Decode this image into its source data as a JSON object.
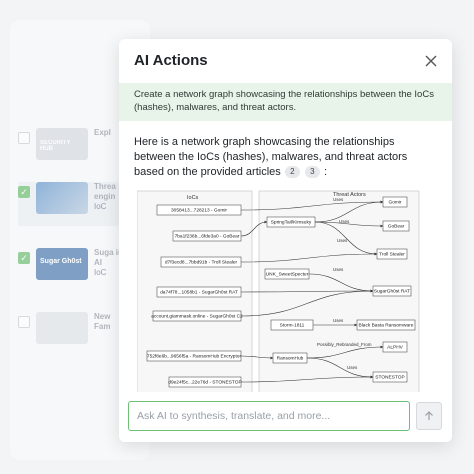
{
  "modal": {
    "title": "AI Actions",
    "prompt": "Create a network graph showcasing the relationships between the IoCs (hashes), malwares, and threat actors.",
    "answer_text": "Here is a network graph showcasing the relationships between the IoCs (hashes), malwares, and threat actors based on the provided articles",
    "answer_suffix": ":",
    "citations": [
      "2",
      "3"
    ]
  },
  "input": {
    "placeholder": "Ask AI to synthesis, translate, and more..."
  },
  "background_list": {
    "items": [
      {
        "title": "Expl",
        "tag": "",
        "checked": false
      },
      {
        "title": "Threa engin",
        "tag": "IoC",
        "checked": true
      },
      {
        "title": "Suga in AI",
        "tag": "IoC",
        "checked": true
      },
      {
        "title": "New Fam",
        "tag": "",
        "checked": false
      }
    ],
    "thumb_labels": [
      "SECURITY HUB",
      "Sugar Gh0st"
    ]
  },
  "graph": {
    "ioc_group_label": "IoCs",
    "actor_group_label": "Threat Actors",
    "iocs": [
      "3058413...728213 - Gomir",
      "7ba1f236b...6fde3a0 - GoBear",
      "d7f3ecd8...7bbd91b - Troll Stealer",
      "da74f78...1058b1 - SugarGh0st RAT",
      "account.giammask.online - SugarGh0st C2",
      "752f8e6b...9656f5a - RansomHub Encryptor",
      "d9e24f5c...22e76d - STONESTOP"
    ],
    "actors": [
      "SpringTail/Kimsuky",
      "UNK_SweetSpecter",
      "Storm-1811",
      "RansomHub"
    ],
    "malwares": [
      "Gomir",
      "GoBear",
      "Troll Stealer",
      "SugarGh0st RAT",
      "Black Basta Ransomware",
      "ALPHV",
      "STONESTOP"
    ],
    "edge_label_uses": "Uses",
    "edge_label_rebranded": "Possibly_Rebranded_From"
  }
}
